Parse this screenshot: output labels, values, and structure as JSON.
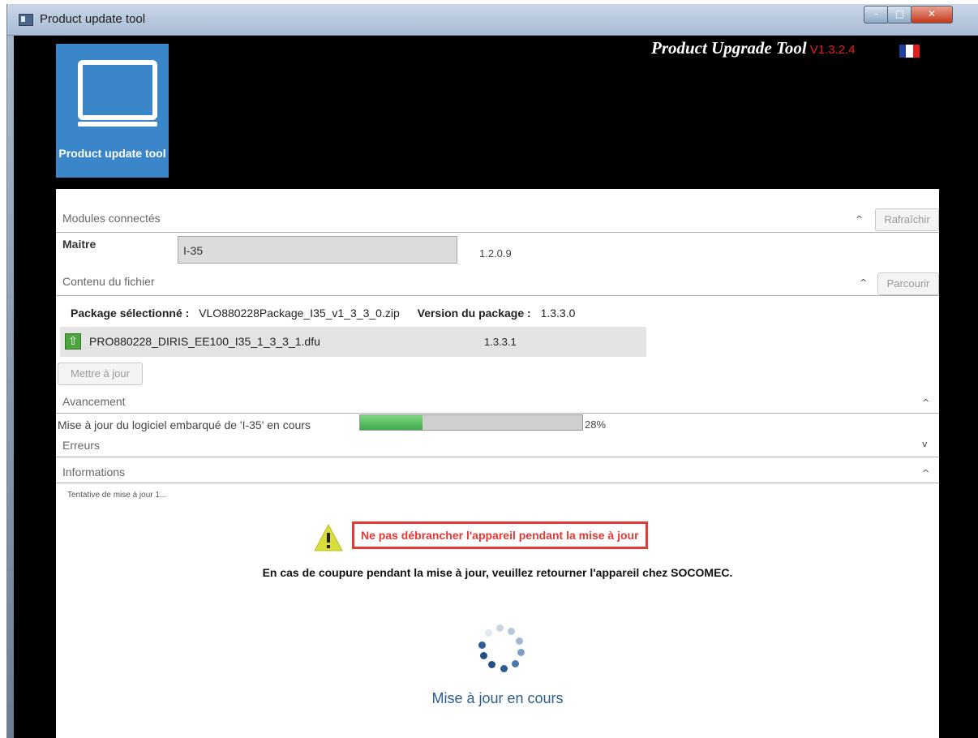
{
  "window": {
    "title": "Product update tool",
    "controls": {
      "minimize": "–",
      "maximize": "□",
      "close": "✕"
    }
  },
  "app_tile": {
    "label": "Product update tool",
    "icon": "laptop-icon",
    "color": "#3a86c8"
  },
  "brand": {
    "name": "Product Upgrade Tool",
    "version": "V1.3.2.4",
    "language_flag": "flag-fr-icon"
  },
  "modules": {
    "header": "Modules connectés",
    "refresh_label": "Rafraîchir",
    "master_label": "Maitre",
    "master_value": "I-35",
    "master_version": "1.2.0.9"
  },
  "file_content": {
    "header": "Contenu du fichier",
    "browse_label": "Parcourir",
    "package_label": "Package sélectionné :",
    "package_value": "VLO880228Package_I35_v1_3_3_0.zip",
    "package_version_label": "Version du package :",
    "package_version_value": "1.3.3.0",
    "file_name": "PRO880228_DIRIS_EE100_I35_1_3_3_1.dfu",
    "file_version": "1.3.3.1",
    "update_label": "Mettre à jour"
  },
  "progress": {
    "header": "Avancement",
    "text": "Mise à jour du logiciel embarqué de 'I-35' en cours",
    "percent": 28,
    "percent_label": "28%"
  },
  "errors": {
    "header": "Erreurs"
  },
  "informations": {
    "header": "Informations",
    "message": "Tentative de mise à jour 1...",
    "warning": "Ne pas débrancher l'appareil pendant la mise à jour",
    "notice": "En cas de coupure pendant la mise à jour, veuillez retourner l'appareil chez SOCOMEC.",
    "busy_text": "Mise à jour en cours"
  },
  "colors": {
    "warning_red": "#e53935",
    "progress_green": "#3fa84a",
    "tile_blue": "#3a86c8",
    "busy_blue": "#2c5d8f"
  }
}
